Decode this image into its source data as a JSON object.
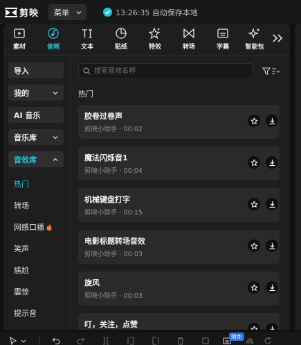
{
  "app": {
    "logo_text": "剪映",
    "menu_label": "菜单",
    "save_status": "13:26:35 自动保存本地",
    "accent": "#27c0d3"
  },
  "tabs": [
    {
      "label": "素材",
      "icon": "media-icon"
    },
    {
      "label": "音频",
      "icon": "audio-icon",
      "active": true
    },
    {
      "label": "文本",
      "icon": "text-icon"
    },
    {
      "label": "贴纸",
      "icon": "sticker-icon"
    },
    {
      "label": "特效",
      "icon": "effects-icon"
    },
    {
      "label": "转场",
      "icon": "transition-icon"
    },
    {
      "label": "字幕",
      "icon": "subtitle-icon"
    },
    {
      "label": "智能包",
      "icon": "smart-icon"
    }
  ],
  "sidebar": {
    "import": "导入",
    "mine": "我的",
    "ai_music": "AI 音乐",
    "music_lib": "音乐库",
    "sfx_lib": "音效库",
    "sub_items": [
      "热门",
      "转场",
      "网感口播",
      "笑声",
      "尴尬",
      "震惊",
      "提示音"
    ]
  },
  "search": {
    "placeholder": "搜索音效名称"
  },
  "section_title": "热门",
  "sounds": [
    {
      "title": "胶卷过卷声",
      "meta": "剪映小助手 · 00:02"
    },
    {
      "title": "魔法闪烁音1",
      "meta": "剪映小助手 · 00:04"
    },
    {
      "title": "机械键盘打字",
      "meta": "剪映小助手 · 00:15"
    },
    {
      "title": "电影标题转场音效",
      "meta": "剪映小助手 · 00:03"
    },
    {
      "title": "旋风",
      "meta": "剪映小助手 · 00:03"
    },
    {
      "title": "叮，关注，点赞",
      "meta": ""
    }
  ],
  "bottom": {
    "badge": "限免"
  }
}
